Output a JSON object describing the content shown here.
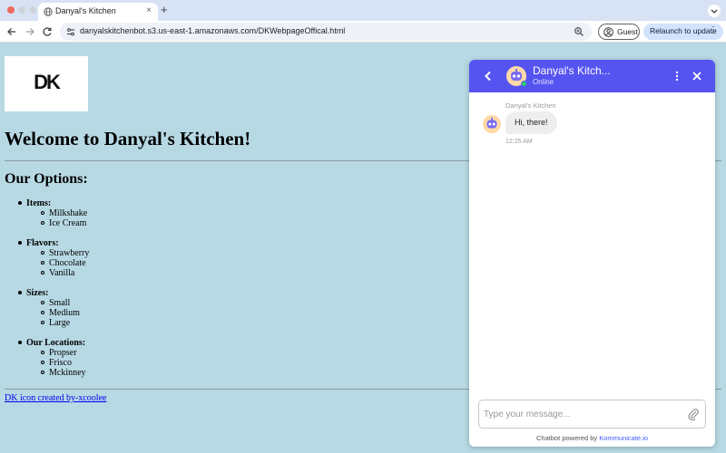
{
  "browser": {
    "tab_title": "Danyal's Kitchen",
    "new_tab_label": "+",
    "url": "danyalskitchenbot.s3.us-east-1.amazonaws.com/DKWebpageOffical.html",
    "guest_label": "Guest",
    "relaunch_label": "Relaunch to update"
  },
  "page": {
    "logo_text": "DK",
    "heading": "Welcome to Danyal's Kitchen!",
    "options_heading": "Our Options:",
    "options": [
      {
        "title": "Items:",
        "values": [
          "Milkshake",
          "Ice Cream"
        ]
      },
      {
        "title": "Flavors:",
        "values": [
          "Strawberry",
          "Chocolate",
          "Vanilla"
        ]
      },
      {
        "title": "Sizes:",
        "values": [
          "Small",
          "Medium",
          "Large"
        ]
      },
      {
        "title": "Our Locations:",
        "values": [
          "Propser",
          "Frisco",
          "Mckinney"
        ]
      }
    ],
    "credit_link": "DK icon created by-xcoolee"
  },
  "chat": {
    "bot_name": "Danyal's Kitch...",
    "status": "Online",
    "sender_name": "Danyal's Kitchen",
    "message": "Hi, there!",
    "message_time": "12:25 AM",
    "input_placeholder": "Type your message...",
    "powered_by": "Chatbot powered by",
    "powered_brand": "Kommunicate.io"
  },
  "colors": {
    "page_background": "#b7d9e4",
    "chat_header": "#5554f0",
    "link": "#0000ee",
    "online": "#2ecc71"
  },
  "icons": [
    "globe-icon",
    "close-icon",
    "back-icon",
    "forward-icon",
    "reload-icon",
    "site-settings-icon",
    "zoom-icon",
    "guest-icon",
    "more-icon",
    "chevron-down-icon",
    "chevron-left-icon",
    "bot-avatar",
    "attach-icon"
  ]
}
